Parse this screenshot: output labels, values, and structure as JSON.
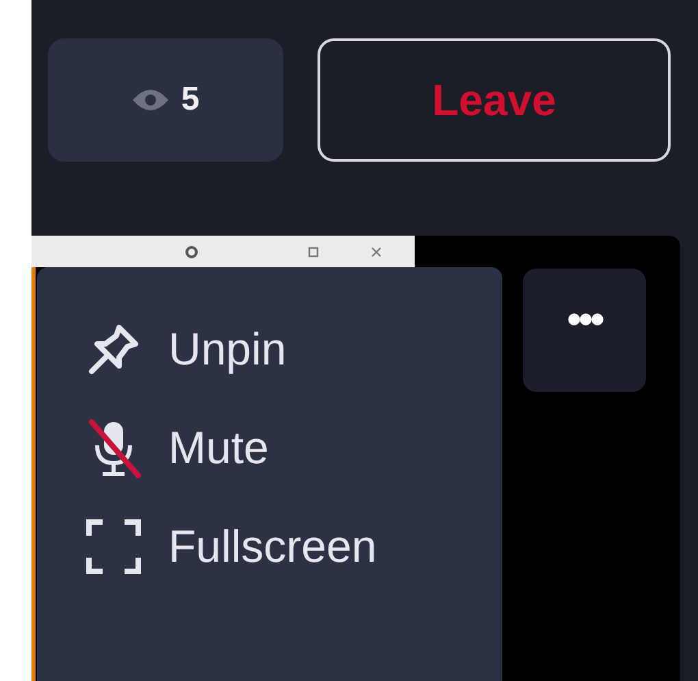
{
  "viewers": {
    "count": "5"
  },
  "leave_button": {
    "label": "Leave"
  },
  "more_button": {
    "label": "•••"
  },
  "menu": {
    "items": [
      {
        "kind": "pin",
        "label": "Unpin"
      },
      {
        "kind": "mic-off",
        "label": "Mute"
      },
      {
        "kind": "fullscreen",
        "label": "Fullscreen"
      }
    ]
  }
}
